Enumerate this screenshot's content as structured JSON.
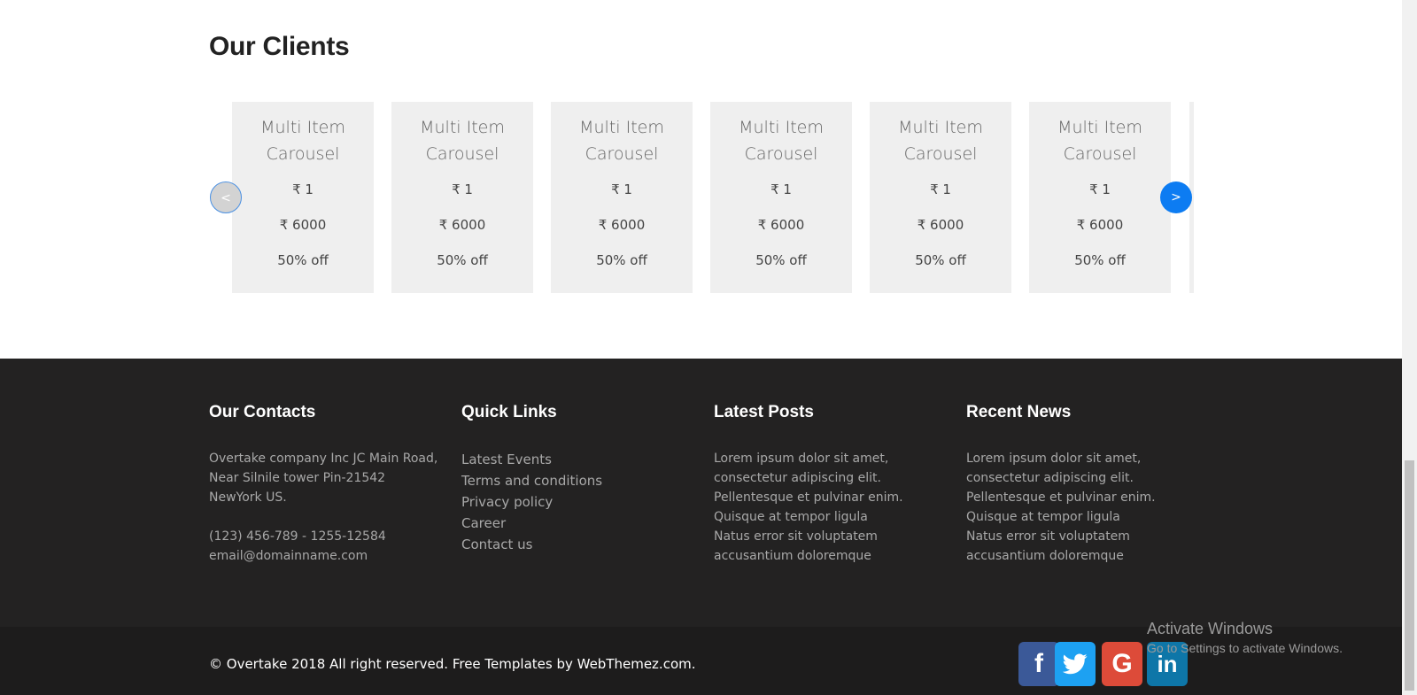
{
  "clients": {
    "title": "Our Clients",
    "cards": [
      {
        "title": "Multi Item Carousel",
        "price1": "₹ 1",
        "price2": "₹ 6000",
        "discount": "50% off"
      },
      {
        "title": "Multi Item Carousel",
        "price1": "₹ 1",
        "price2": "₹ 6000",
        "discount": "50% off"
      },
      {
        "title": "Multi Item Carousel",
        "price1": "₹ 1",
        "price2": "₹ 6000",
        "discount": "50% off"
      },
      {
        "title": "Multi Item Carousel",
        "price1": "₹ 1",
        "price2": "₹ 6000",
        "discount": "50% off"
      },
      {
        "title": "Multi Item Carousel",
        "price1": "₹ 1",
        "price2": "₹ 6000",
        "discount": "50% off"
      },
      {
        "title": "Multi Item Carousel",
        "price1": "₹ 1",
        "price2": "₹ 6000",
        "discount": "50% off"
      }
    ],
    "prev_label": "<",
    "next_label": ">"
  },
  "footer": {
    "contacts": {
      "title": "Our Contacts",
      "address": "Overtake company Inc JC Main Road, Near Silnile tower Pin-21542 NewYork US.",
      "phone": "(123) 456-789 - 1255-12584",
      "email": "email@domainname.com"
    },
    "quick_links": {
      "title": "Quick Links",
      "items": [
        "Latest Events",
        "Terms and conditions",
        "Privacy policy",
        "Career",
        "Contact us"
      ]
    },
    "latest_posts": {
      "title": "Latest Posts",
      "text": "Lorem ipsum dolor sit amet, consectetur adipiscing elit. Pellentesque et pulvinar enim. Quisque at tempor ligula Natus error sit voluptatem accusantium doloremque"
    },
    "recent_news": {
      "title": "Recent News",
      "text": "Lorem ipsum dolor sit amet, consectetur adipiscing elit. Pellentesque et pulvinar enim. Quisque at tempor ligula Natus error sit voluptatem accusantium doloremque"
    },
    "copyright": "© Overtake 2018 All right reserved. Free Templates by WebThemez.com.",
    "social": {
      "facebook": "f",
      "twitter": "🐦",
      "google": "G",
      "linkedin": "in"
    }
  },
  "watermark": {
    "line1": "Activate Windows",
    "line2": "Go to Settings to activate Windows."
  },
  "colors": {
    "accent": "#0d7cf2",
    "footer_bg": "#232222",
    "card_bg": "#efefef"
  }
}
